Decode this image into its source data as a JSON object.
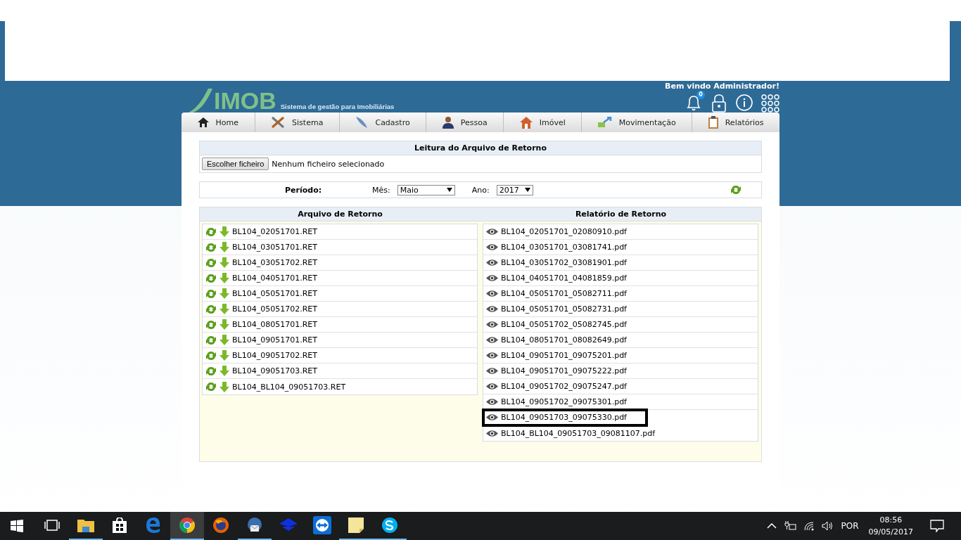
{
  "header": {
    "logo": "IMOB",
    "tagline": "Sistema de gestão para Imobiliárias",
    "greeting": "Bem vindo Administrador!",
    "notification_count": "0"
  },
  "nav": [
    {
      "label": "Home",
      "kind": "home"
    },
    {
      "label": "Sistema",
      "kind": "tools"
    },
    {
      "label": "Cadastro",
      "kind": "feather"
    },
    {
      "label": "Pessoa",
      "kind": "person"
    },
    {
      "label": "Imóvel",
      "kind": "house"
    },
    {
      "label": "Movimentação",
      "kind": "arrows"
    },
    {
      "label": "Relatórios",
      "kind": "clipboard"
    }
  ],
  "upload": {
    "title": "Leitura do Arquivo de Retorno",
    "button": "Escolher ficheiro",
    "status": "Nenhum ficheiro selecionado"
  },
  "period": {
    "label": "Período:",
    "month_label": "Mês:",
    "month": "Maio",
    "year_label": "Ano:",
    "year": "2017"
  },
  "files": {
    "title": "Arquivo de Retorno",
    "items": [
      "BL104_02051701.RET",
      "BL104_03051701.RET",
      "BL104_03051702.RET",
      "BL104_04051701.RET",
      "BL104_05051701.RET",
      "BL104_05051702.RET",
      "BL104_08051701.RET",
      "BL104_09051701.RET",
      "BL104_09051702.RET",
      "BL104_09051703.RET",
      "BL104_BL104_09051703.RET"
    ]
  },
  "reports": {
    "title": "Relatório de Retorno",
    "items": [
      {
        "name": "BL104_02051701_02080910.pdf",
        "highlighted": false
      },
      {
        "name": "BL104_03051701_03081741.pdf",
        "highlighted": false
      },
      {
        "name": "BL104_03051702_03081901.pdf",
        "highlighted": false
      },
      {
        "name": "BL104_04051701_04081859.pdf",
        "highlighted": false
      },
      {
        "name": "BL104_05051701_05082711.pdf",
        "highlighted": false
      },
      {
        "name": "BL104_05051701_05082731.pdf",
        "highlighted": false
      },
      {
        "name": "BL104_05051702_05082745.pdf",
        "highlighted": false
      },
      {
        "name": "BL104_08051701_08082649.pdf",
        "highlighted": false
      },
      {
        "name": "BL104_09051701_09075201.pdf",
        "highlighted": false
      },
      {
        "name": "BL104_09051701_09075222.pdf",
        "highlighted": false
      },
      {
        "name": "BL104_09051702_09075247.pdf",
        "highlighted": false
      },
      {
        "name": "BL104_09051702_09075301.pdf",
        "highlighted": false
      },
      {
        "name": "BL104_09051703_09075330.pdf",
        "highlighted": true
      },
      {
        "name": "BL104_BL104_09051703_09081107.pdf",
        "highlighted": false
      }
    ]
  },
  "taskbar": {
    "apps": [
      {
        "kind": "taskview",
        "running": false,
        "active": false
      },
      {
        "kind": "folder",
        "running": true,
        "active": false
      },
      {
        "kind": "store",
        "running": false,
        "active": false
      },
      {
        "kind": "edge",
        "running": false,
        "active": false
      },
      {
        "kind": "chrome",
        "running": true,
        "active": true
      },
      {
        "kind": "firefox",
        "running": false,
        "active": false
      },
      {
        "kind": "mail",
        "running": true,
        "active": false
      },
      {
        "kind": "bird",
        "running": false,
        "active": false
      },
      {
        "kind": "remote",
        "running": false,
        "active": false
      },
      {
        "kind": "note",
        "running": true,
        "active": false
      },
      {
        "kind": "skype",
        "running": true,
        "active": false
      }
    ],
    "language": "POR",
    "time": "08:56",
    "date": "09/05/2017"
  }
}
